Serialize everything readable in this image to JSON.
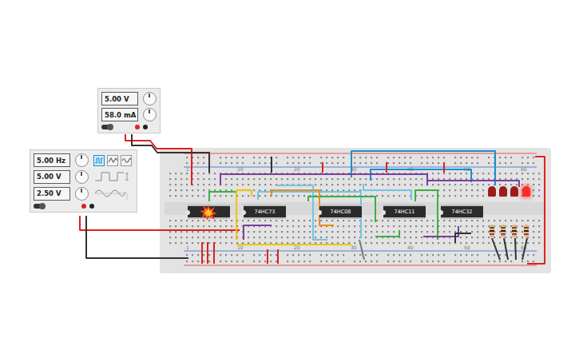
{
  "power_supply": {
    "voltage": "5.00 V",
    "current": "58.0 mA",
    "on": true
  },
  "function_generator": {
    "frequency": "5.00 Hz",
    "amplitude": "5.00 V",
    "offset": "2.50 V",
    "on": true,
    "waveforms": [
      {
        "kind": "square",
        "selected": true
      },
      {
        "kind": "triangle",
        "selected": false
      },
      {
        "kind": "sine",
        "selected": false
      }
    ]
  },
  "breadboard": {
    "column_numbers_top": [
      "1",
      "10",
      "20",
      "30",
      "40",
      "50",
      "60"
    ],
    "column_numbers_bottom": [
      "1",
      "10",
      "20",
      "30",
      "40",
      "50",
      "60"
    ]
  },
  "chips": [
    {
      "label": "",
      "burnt": true
    },
    {
      "label": "74HC73",
      "burnt": false
    },
    {
      "label": "74HC08",
      "burnt": false
    },
    {
      "label": "74HC11",
      "burnt": false
    },
    {
      "label": "74HC32",
      "burnt": false
    }
  ],
  "leds": [
    {
      "on": false
    },
    {
      "on": false
    },
    {
      "on": false
    },
    {
      "on": true
    }
  ],
  "wires": [
    {
      "color": "#e02020"
    },
    {
      "color": "#333333"
    },
    {
      "color": "#e02020"
    },
    {
      "color": "#333333"
    },
    {
      "color": "#1a8fd0"
    },
    {
      "color": "#1a8fd0"
    },
    {
      "color": "#7b3fa0"
    },
    {
      "color": "#7b3fa0"
    },
    {
      "color": "#6ec6e8"
    },
    {
      "color": "#6ec6e8"
    },
    {
      "color": "#6ec6e8"
    },
    {
      "color": "#3cb043"
    },
    {
      "color": "#3cb043"
    },
    {
      "color": "#3cb043"
    },
    {
      "color": "#3cb043"
    },
    {
      "color": "#f2c200"
    },
    {
      "color": "#f2c200"
    },
    {
      "color": "#f08a1c"
    },
    {
      "color": "#7b3fa0"
    },
    {
      "color": "#7b3fa0"
    },
    {
      "color": "#e02020"
    },
    {
      "color": "#e02020"
    },
    {
      "color": "#e02020"
    },
    {
      "color": "#333333"
    },
    {
      "color": "#e02020"
    },
    {
      "color": "#e02020"
    },
    {
      "color": "#e02020"
    },
    {
      "color": "#e02020"
    },
    {
      "color": "#e02020"
    },
    {
      "color": "#333333"
    },
    {
      "color": "#333333"
    },
    {
      "color": "#333333"
    },
    {
      "color": "#333333"
    },
    {
      "color": "#e02020"
    },
    {
      "color": "#333333"
    },
    {
      "color": "#777777"
    }
  ]
}
